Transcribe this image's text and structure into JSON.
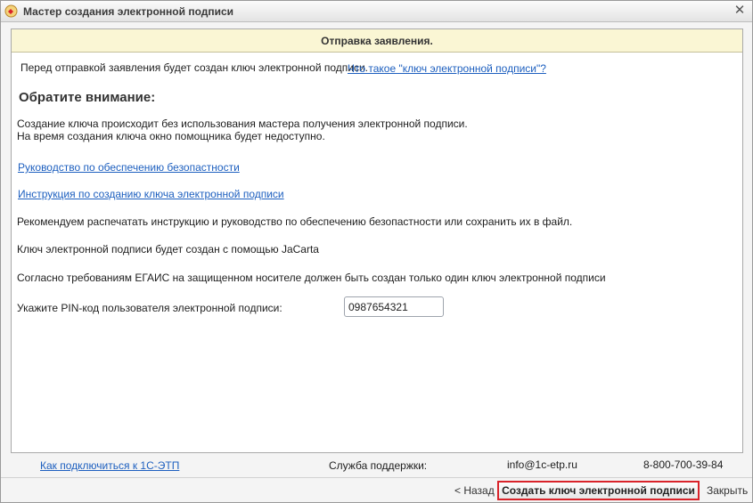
{
  "window": {
    "title": "Мастер создания электронной подписи",
    "icon": "app-icon",
    "close_icon": "close-icon"
  },
  "header": {
    "title": "Отправка заявления."
  },
  "main": {
    "intro_text": "Перед отправкой заявления будет создан ключ электронной подписи.",
    "intro_link": "Что такое \"ключ электронной подписи\"?",
    "attention_heading": "Обратите внимание:",
    "note_line1": "Создание ключа происходит без использования мастера получения электронной подписи.",
    "note_line2": "На время создания ключа окно помощника будет недоступно.",
    "security_link": "Руководство по обеспечению безопастности",
    "instruction_link": "Инструкция по созданию ключа электронной подписи",
    "recommend_text": "Рекомендуем распечатать инструкцию и руководство по обеспечению безопастности или сохранить их в файл.",
    "jacarta_text": "Ключ электронной подписи будет создан с помощью JaCarta",
    "egais_text": "Согласно требованиям ЕГАИС на защищенном носителе должен быть создан только один ключ электронной подписи",
    "pin_label": "Укажите PIN-код пользователя электронной подписи:",
    "pin_value": "0987654321"
  },
  "footer": {
    "connect_link": "Как подключиться к 1С-ЭТП",
    "support_label": "Служба поддержки:",
    "email": "info@1c-etp.ru",
    "phone": "8-800-700-39-84"
  },
  "buttons": {
    "back_label": "< Назад",
    "create_label": "Создать ключ электронной подписи",
    "close_label": "Закрыть"
  },
  "colors": {
    "header_band": "#faf6d4",
    "link": "#1d5fbf",
    "primary_button_border": "#d9232a"
  }
}
